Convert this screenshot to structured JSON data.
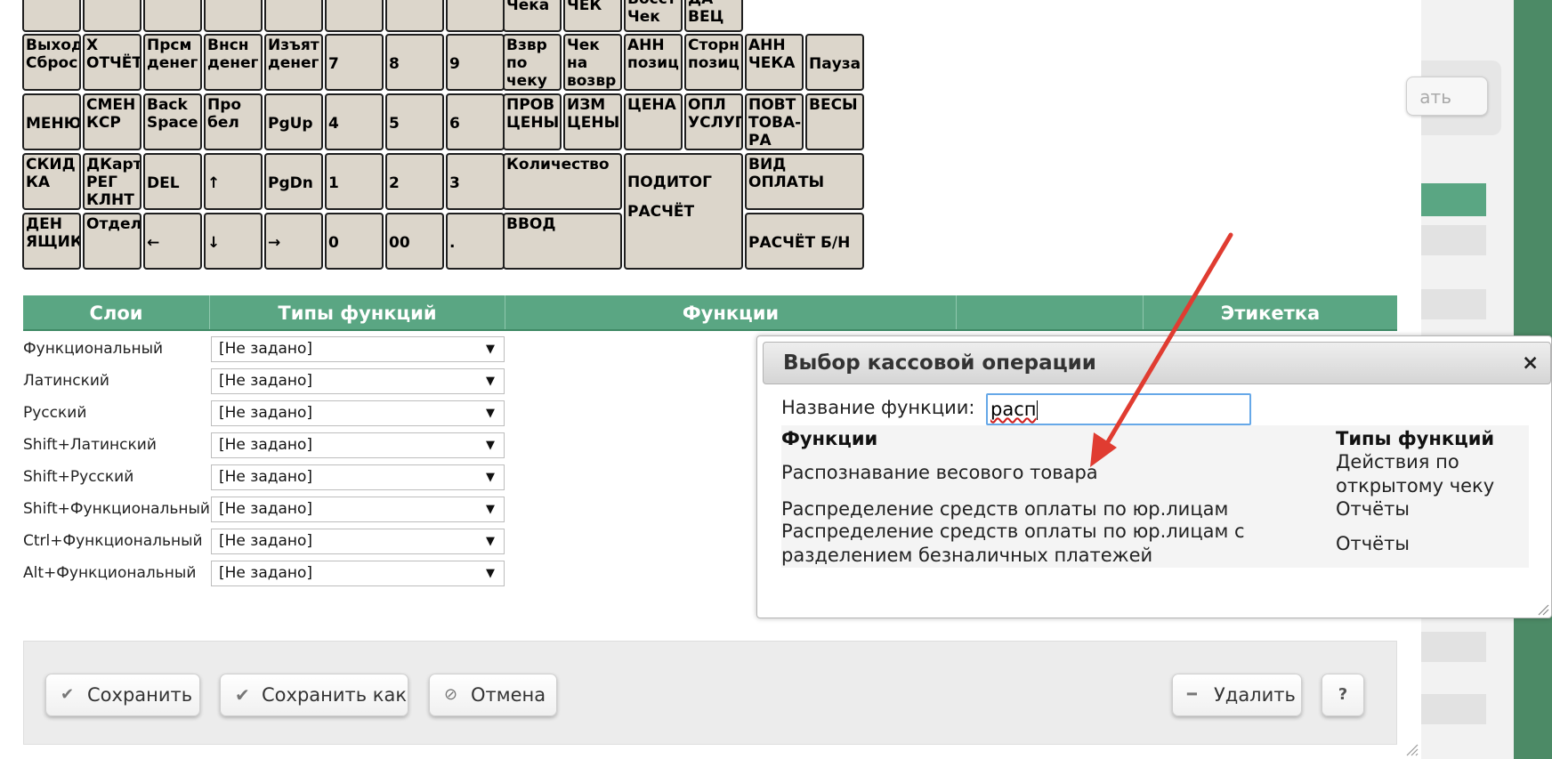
{
  "keyboard": {
    "r0": [
      "",
      "",
      "",
      "",
      "",
      "",
      "",
      "",
      "Чека",
      "ЧЕК",
      "Восст\nЧек",
      "ДА\nВЕЦ"
    ],
    "r1": [
      "Выход\nСброс",
      "X\nОТЧЁТ",
      "Прсм\nденег",
      "Внсн\nденег",
      "Изъят\nденег",
      "7",
      "8",
      "9",
      "Взвр\nпо\nчеку",
      "Чек\nна\nвозвр",
      "АНН\nпозиц",
      "Сторн\nпозиц",
      "АНН\nЧЕКА",
      "Пауза"
    ],
    "r2": [
      "МЕНЮ",
      "СМЕН\nКСР",
      "Back\nSpace",
      "Про\nбел",
      "PgUp",
      "4",
      "5",
      "6",
      "ПРОВ\nЦЕНЫ",
      "ИЗМ\nЦЕНЫ",
      "ЦЕНА",
      "ОПЛ\nУСЛУГ",
      "ПОВТ\nТОВА-\nРА",
      "ВЕСЫ"
    ],
    "r3": [
      "СКИД\nКА",
      "ДКарт\nРЕГ\nКЛНТ",
      "DEL",
      "↑",
      "PgDn",
      "1",
      "2",
      "3",
      "Количество",
      "ПОДИТОГ",
      "ВИД\nОПЛАТЫ"
    ],
    "r4": [
      "ДЕН\nЯЩИК",
      "Отдел",
      "←",
      "↓",
      "→",
      "0",
      "00",
      ".",
      "ВВОД",
      "РАСЧЁТ",
      "РАСЧЁТ Б/Н"
    ]
  },
  "table_headers": [
    "Слои",
    "Типы функций",
    "Функции",
    "",
    "Этикетка"
  ],
  "layers": [
    {
      "label": "Функциональный",
      "value": "[Не задано]"
    },
    {
      "label": "Латинский",
      "value": "[Не задано]"
    },
    {
      "label": "Русский",
      "value": "[Не задано]"
    },
    {
      "label": "Shift+Латинский",
      "value": "[Не задано]"
    },
    {
      "label": "Shift+Русский",
      "value": "[Не задано]"
    },
    {
      "label": "Shift+Функциональный",
      "value": "[Не задано]"
    },
    {
      "label": "Ctrl+Функциональный",
      "value": "[Не задано]"
    },
    {
      "label": "Alt+Функциональный",
      "value": "[Не задано]"
    }
  ],
  "dialog": {
    "title": "Выбор кассовой операции",
    "close": "×",
    "fn_label": "Название функции:",
    "fn_value": "расп",
    "col_functions": "Функции",
    "col_types": "Типы функций",
    "rows": [
      {
        "function": "Распознавание весового товара",
        "type": "Действия по\nоткрытому чеку"
      },
      {
        "function": "Распределение средств оплаты по юр.лицам",
        "type": "Отчёты"
      },
      {
        "function": "Распределение средств оплаты по юр.лицам с\nразделением безналичных платежей",
        "type": "Отчёты"
      }
    ]
  },
  "footer": {
    "save": "Сохранить",
    "save_as": "Сохранить как",
    "cancel": "Отмена",
    "delete": "Удалить",
    "help": "?"
  },
  "background": {
    "button_fragment": "ать"
  },
  "arrow_color": "#e03c31",
  "header_green": "#5aa683"
}
